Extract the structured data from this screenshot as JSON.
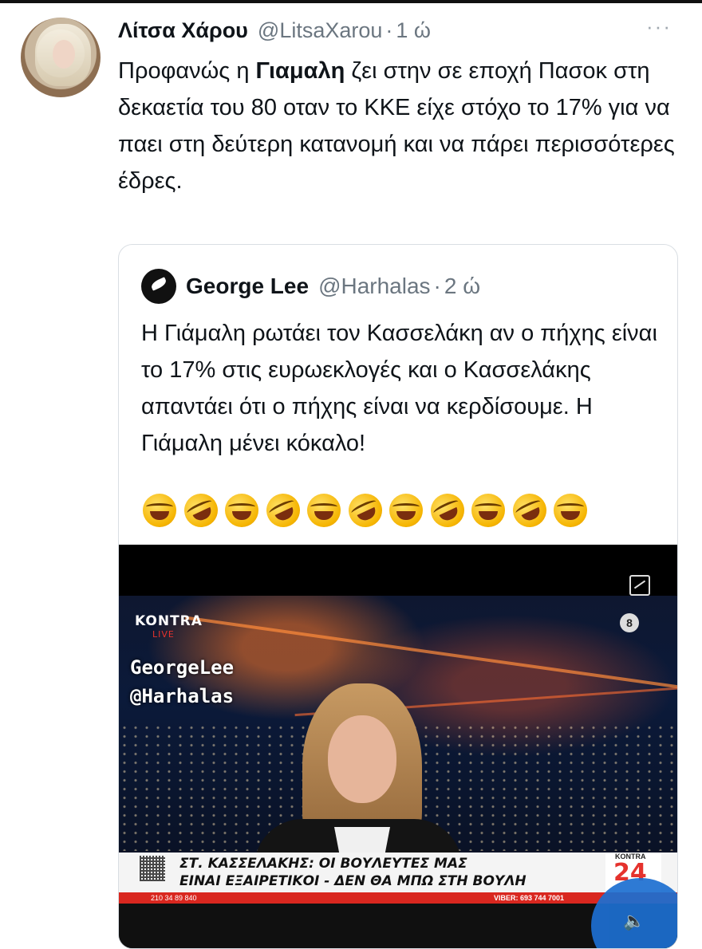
{
  "tweet": {
    "author_name": "Λίτσα Χάρου",
    "author_handle": "@LitsaXarou",
    "separator": "·",
    "age": "1 ώ",
    "more": "···",
    "text_before_bold": "Προφανώς η ",
    "text_bold": "Γιαμαλη",
    "text_after_bold": " ζει στην σε εποχή Πασοκ στη δεκαετία του 80 οταν το ΚΚΕ είχε στόχο το 17% για να παει στη δεύτερη κατανομή και να πάρει περισσότερες έδρες."
  },
  "quoted": {
    "author_name": "George Lee",
    "author_handle": "@Harhalas",
    "separator": "·",
    "age": "2 ώ",
    "text": "Η Γιάμαλη ρωτάει τον Κασσελάκη αν ο πήχης είναι το 17% στις ευρωεκλογές και ο Κασσελάκης απαντάει ότι ο πήχης είναι να κερδίσουμε. Η Γιάμαλη μένει κόκαλο!",
    "emojis": [
      "joy-emoji",
      "rofl-emoji",
      "joy-emoji",
      "rofl-emoji",
      "joy-emoji",
      "rofl-emoji",
      "joy-emoji",
      "rofl-emoji",
      "joy-emoji",
      "rofl-emoji",
      "joy-emoji"
    ]
  },
  "video": {
    "channel_logo": "KONTRA",
    "channel_logo_sub": "LIVE",
    "watermark_line1": "GeorgeLee",
    "watermark_line2": "@Harhalas",
    "ticker_line1": "ΣΤ. ΚΑΣΣΕΛΑΚΗΣ: ΟΙ ΒΟΥΛΕΥΤΕΣ ΜΑΣ",
    "ticker_line2": "ΕΙΝΑΙ ΕΞΑΙΡΕΤΙΚΟΙ - ΔΕΝ ΘΑ ΜΠΩ ΣΤΗ ΒΟΥΛΗ",
    "ticker_phone": "210 34 89 840",
    "ticker_viber": "VIBER: 693 744 7001",
    "channel_badge_top": "KONTRA",
    "channel_badge_num": "24",
    "timer": "8"
  },
  "colors": {
    "text": "#0f1419",
    "secondary": "#6b7680",
    "border": "#d9dee3",
    "mute_button": "#1d6fd1",
    "ticker_red": "#d9271f"
  }
}
